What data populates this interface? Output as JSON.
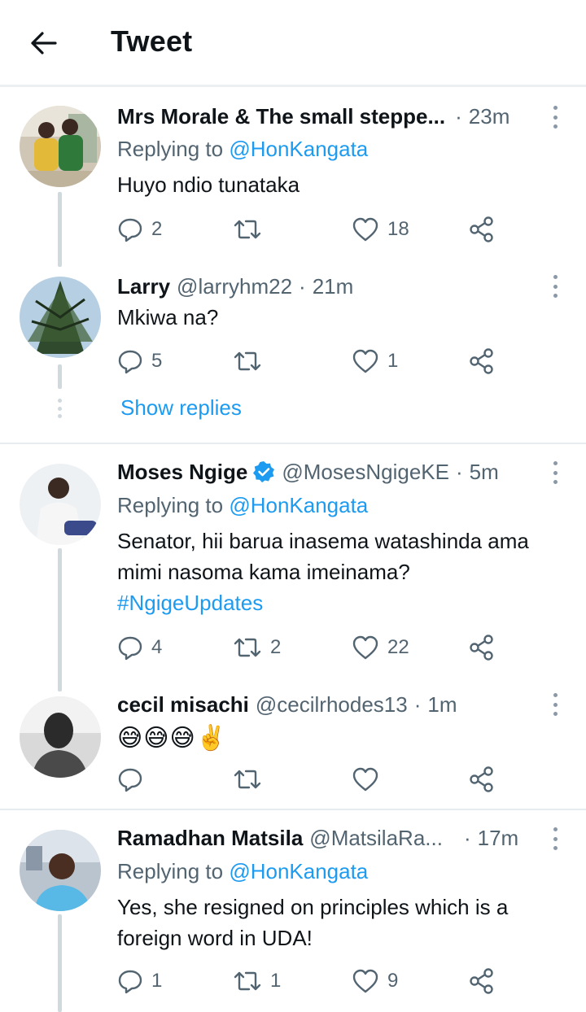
{
  "header": {
    "title": "Tweet",
    "back_icon": "arrow-left-icon"
  },
  "colors": {
    "link": "#1d9bf0",
    "secondary_text": "#536471",
    "primary_text": "#0f1419",
    "thread_line": "#cfd9de"
  },
  "replies": [
    {
      "name": "Mrs Morale & The small steppe...",
      "handle": "",
      "separator": "·",
      "time": "23m",
      "replying_prefix": "Replying to",
      "replying_to": "@HonKangata",
      "text": "Huyo ndio tunataka",
      "counts": {
        "reply": "2",
        "retweet": "",
        "like": "18"
      }
    },
    {
      "name": "Larry",
      "handle": "@larryhm22",
      "separator": "·",
      "time": "21m",
      "text": "Mkiwa na?",
      "counts": {
        "reply": "5",
        "retweet": "",
        "like": "1"
      }
    },
    {
      "name": "Moses Ngige",
      "handle": "@MosesNgigeKE",
      "separator": "·",
      "time": "5m",
      "verified": true,
      "replying_prefix": "Replying to",
      "replying_to": "@HonKangata",
      "text_line1": "Senator, hii barua inasema watashinda ama",
      "text_line2": "mimi nasoma kama imeinama?",
      "hashtag": "#NgigeUpdates",
      "counts": {
        "reply": "4",
        "retweet": "2",
        "like": "22"
      }
    },
    {
      "name": "cecil misachi",
      "handle": "@cecilrhodes13",
      "separator": "·",
      "time": "1m",
      "text": "😅😅😅✌️",
      "counts": {
        "reply": "",
        "retweet": "",
        "like": ""
      }
    },
    {
      "name": "Ramadhan Matsila",
      "handle": "@MatsilaRa...",
      "separator": "·",
      "time": "17m",
      "replying_prefix": "Replying to",
      "replying_to": "@HonKangata",
      "text_line1": "Yes, she resigned on principles which is a",
      "text_line2": "foreign word in UDA!",
      "counts": {
        "reply": "1",
        "retweet": "1",
        "like": "9"
      }
    }
  ],
  "show_replies_label": "Show replies",
  "action_icons": [
    "reply-icon",
    "retweet-icon",
    "like-icon",
    "share-icon"
  ]
}
